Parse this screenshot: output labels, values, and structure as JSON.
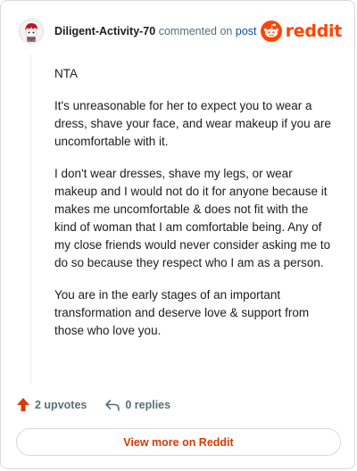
{
  "header": {
    "author": "Diligent-Activity-70",
    "action_text": "commented on",
    "target_link": "post",
    "brand_word": "reddit"
  },
  "comment": {
    "paragraphs": [
      "NTA",
      "It's unreasonable for her to expect you to wear a dress, shave your face, and wear makeup if you are uncomfortable with it.",
      "I don't wear dresses, shave my legs, or wear makeup and I would not do it for anyone because it makes me uncomfortable & does not fit with the kind of woman that I am comfortable being. Any of my close friends would never consider asking me to do so because they respect who I am as a person.",
      "You are in the early stages of an important transformation and deserve love & support from those who love you."
    ]
  },
  "actions": {
    "upvotes": "2 upvotes",
    "replies": "0 replies"
  },
  "footer": {
    "view_more": "View more on Reddit"
  },
  "colors": {
    "brand": "#ff4500",
    "link": "#0a4f9e",
    "upvote": "#d93a00"
  },
  "icons": [
    "avatar",
    "reddit-logo-icon",
    "upvote-arrow-icon",
    "reply-icon"
  ]
}
